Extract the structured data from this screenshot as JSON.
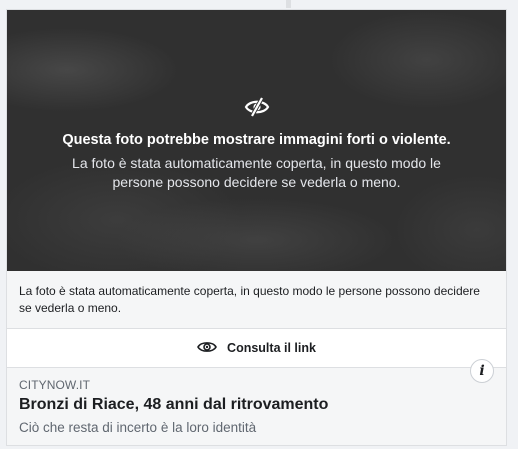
{
  "cover": {
    "icon": "eye-slash-icon",
    "title": "Questa foto potrebbe mostrare immagini forti o violente.",
    "description": "La foto è stata automaticamente coperta, in questo modo le persone possono decidere se vederla o meno."
  },
  "notice": {
    "text": "La foto è stata automaticamente coperta, in questo modo le persone possono decidere se vederla o meno."
  },
  "consult": {
    "icon": "eye-icon",
    "label": "Consulta il link"
  },
  "link_preview": {
    "domain": "CITYNOW.IT",
    "headline": "Bronzi di Riace, 48 anni dal ritrovamento",
    "subtitle": "Ciò che resta di incerto è la loro identità",
    "info_icon": "info-icon",
    "info_label": "i"
  },
  "colors": {
    "cover_bg": "#303030",
    "text_primary": "#1c1e21",
    "text_secondary": "#606770"
  }
}
